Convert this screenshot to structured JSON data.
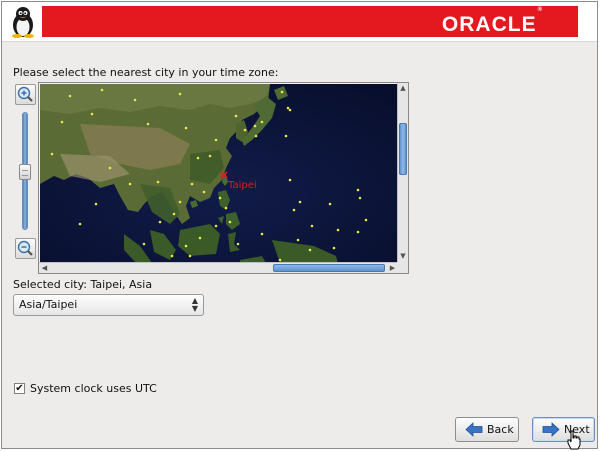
{
  "header": {
    "logo_text": "ORACLE",
    "logo_mark": "®",
    "brand_color": "#e4181f",
    "left_icon": "tux-penguin-icon"
  },
  "timezone": {
    "prompt": "Please select the nearest city in your time zone:",
    "map": {
      "highlighted_city": "Taipei",
      "marker_color": "#e4181f",
      "city_dot_color": "#e8e84a"
    },
    "selected_city_label": "Selected city: Taipei, Asia",
    "select_value": "Asia/Taipei"
  },
  "options": {
    "utc_checked": true,
    "utc_label": "System clock uses UTC"
  },
  "buttons": {
    "back_label": "Back",
    "next_label": "Next",
    "back_icon": "arrow-left-icon",
    "next_icon": "arrow-right-icon"
  }
}
